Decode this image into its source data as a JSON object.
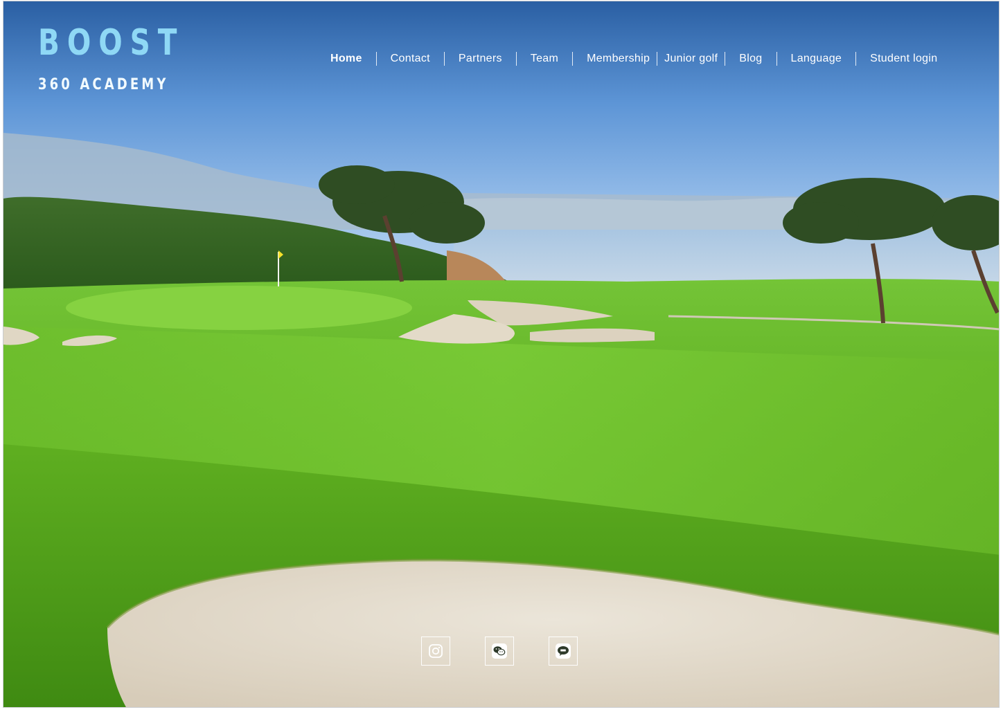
{
  "logo": {
    "title": "BOOST",
    "subtitle": "360 ACADEMY"
  },
  "nav": {
    "items": [
      {
        "label": "Home",
        "active": true
      },
      {
        "label": "Contact"
      },
      {
        "label": "Partners"
      },
      {
        "label": "Team"
      },
      {
        "label": "Membership"
      },
      {
        "label": "Junior golf"
      },
      {
        "label": "Blog"
      },
      {
        "label": "Language"
      },
      {
        "label": "Student login"
      }
    ]
  },
  "social": [
    {
      "icon": "instagram-icon"
    },
    {
      "icon": "wechat-icon"
    },
    {
      "icon": "kakaotalk-icon"
    }
  ],
  "colors": {
    "logo_accent": "#8fd8f5",
    "sky_top": "#2a64a8",
    "grass": "#5fb321",
    "sand": "#e6dfd2"
  }
}
